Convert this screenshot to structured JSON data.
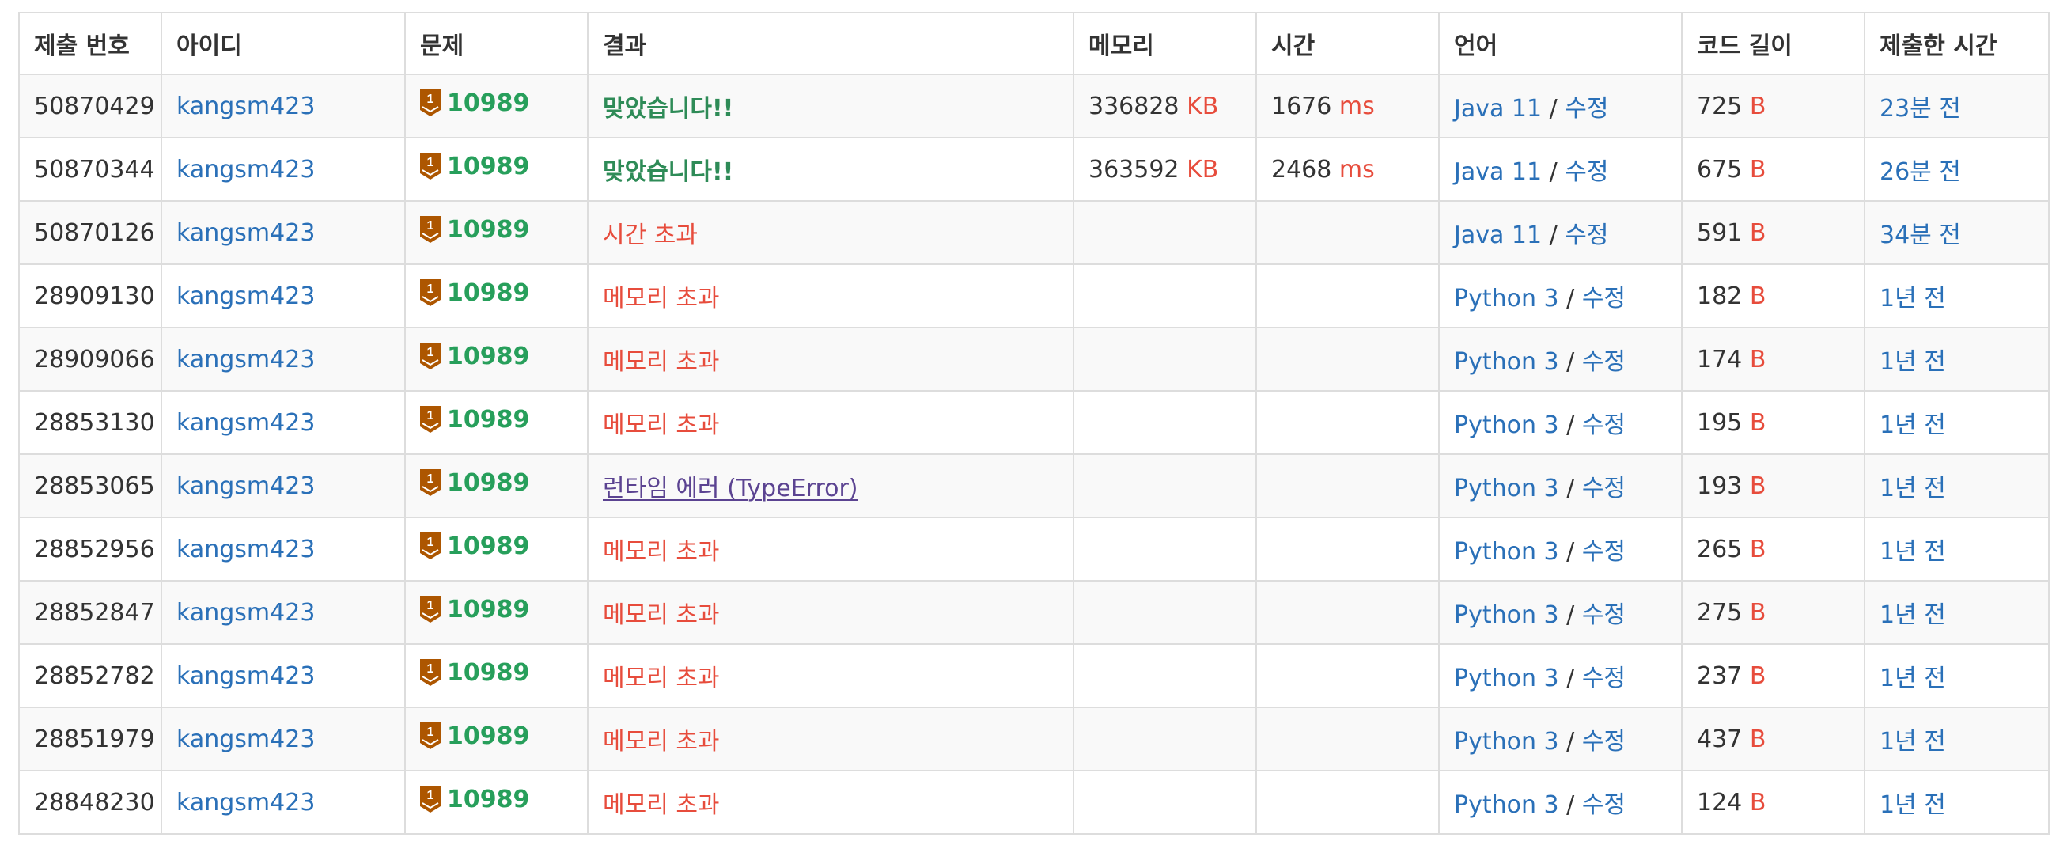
{
  "colors": {
    "link": "#2a70b8",
    "problem": "#279f5b",
    "accepted": "#2e8b57",
    "error": "#e74c3c",
    "runtime_error": "#5b4391",
    "tier_bronze": "#ad5600"
  },
  "table": {
    "headers": [
      "제출 번호",
      "아이디",
      "문제",
      "결과",
      "메모리",
      "시간",
      "언어",
      "코드 길이",
      "제출한 시간"
    ],
    "memory_unit": "KB",
    "time_unit": "ms",
    "length_unit": "B",
    "edit_label": "수정",
    "separator": "/",
    "problem_tier_icon": "bronze-tier-1-icon",
    "rows": [
      {
        "id": "50870429",
        "user": "kangsm423",
        "problem": "10989",
        "tier": "1",
        "result": "맞았습니다!!",
        "status": "ac",
        "memory": "336828",
        "time": "1676",
        "lang": "Java 11",
        "length": "725",
        "submitted": "23분 전"
      },
      {
        "id": "50870344",
        "user": "kangsm423",
        "problem": "10989",
        "tier": "1",
        "result": "맞았습니다!!",
        "status": "ac",
        "memory": "363592",
        "time": "2468",
        "lang": "Java 11",
        "length": "675",
        "submitted": "26분 전"
      },
      {
        "id": "50870126",
        "user": "kangsm423",
        "problem": "10989",
        "tier": "1",
        "result": "시간 초과",
        "status": "fail",
        "memory": "",
        "time": "",
        "lang": "Java 11",
        "length": "591",
        "submitted": "34분 전"
      },
      {
        "id": "28909130",
        "user": "kangsm423",
        "problem": "10989",
        "tier": "1",
        "result": "메모리 초과",
        "status": "fail",
        "memory": "",
        "time": "",
        "lang": "Python 3",
        "length": "182",
        "submitted": "1년 전"
      },
      {
        "id": "28909066",
        "user": "kangsm423",
        "problem": "10989",
        "tier": "1",
        "result": "메모리 초과",
        "status": "fail",
        "memory": "",
        "time": "",
        "lang": "Python 3",
        "length": "174",
        "submitted": "1년 전"
      },
      {
        "id": "28853130",
        "user": "kangsm423",
        "problem": "10989",
        "tier": "1",
        "result": "메모리 초과",
        "status": "fail",
        "memory": "",
        "time": "",
        "lang": "Python 3",
        "length": "195",
        "submitted": "1년 전"
      },
      {
        "id": "28853065",
        "user": "kangsm423",
        "problem": "10989",
        "tier": "1",
        "result": "런타임 에러 (TypeError)",
        "status": "rte",
        "memory": "",
        "time": "",
        "lang": "Python 3",
        "length": "193",
        "submitted": "1년 전"
      },
      {
        "id": "28852956",
        "user": "kangsm423",
        "problem": "10989",
        "tier": "1",
        "result": "메모리 초과",
        "status": "fail",
        "memory": "",
        "time": "",
        "lang": "Python 3",
        "length": "265",
        "submitted": "1년 전"
      },
      {
        "id": "28852847",
        "user": "kangsm423",
        "problem": "10989",
        "tier": "1",
        "result": "메모리 초과",
        "status": "fail",
        "memory": "",
        "time": "",
        "lang": "Python 3",
        "length": "275",
        "submitted": "1년 전"
      },
      {
        "id": "28852782",
        "user": "kangsm423",
        "problem": "10989",
        "tier": "1",
        "result": "메모리 초과",
        "status": "fail",
        "memory": "",
        "time": "",
        "lang": "Python 3",
        "length": "237",
        "submitted": "1년 전"
      },
      {
        "id": "28851979",
        "user": "kangsm423",
        "problem": "10989",
        "tier": "1",
        "result": "메모리 초과",
        "status": "fail",
        "memory": "",
        "time": "",
        "lang": "Python 3",
        "length": "437",
        "submitted": "1년 전"
      },
      {
        "id": "28848230",
        "user": "kangsm423",
        "problem": "10989",
        "tier": "1",
        "result": "메모리 초과",
        "status": "fail",
        "memory": "",
        "time": "",
        "lang": "Python 3",
        "length": "124",
        "submitted": "1년 전"
      }
    ]
  }
}
